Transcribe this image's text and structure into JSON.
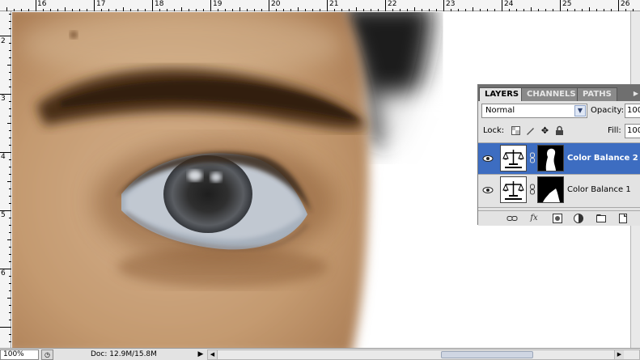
{
  "ruler": {
    "top_ticks": [
      "16",
      "17",
      "18",
      "19",
      "20",
      "21",
      "22",
      "23",
      "24",
      "25",
      "26"
    ],
    "left_ticks": [
      "2",
      "3",
      "4",
      "5",
      "6"
    ]
  },
  "status": {
    "zoom": "100%",
    "doc_info": "Doc: 12.9M/15.8M"
  },
  "layers_panel": {
    "tabs": [
      {
        "label": "LAYERS",
        "active": true
      },
      {
        "label": "CHANNELS",
        "active": false
      },
      {
        "label": "PATHS",
        "active": false
      }
    ],
    "blend_mode": "Normal",
    "opacity_label": "Opacity:",
    "opacity_value": "100",
    "lock_label": "Lock:",
    "fill_label": "Fill:",
    "fill_value": "100",
    "layers": [
      {
        "name": "Color Balance 2",
        "selected": true
      },
      {
        "name": "Color Balance 1",
        "selected": false
      }
    ],
    "icons": {
      "visibility": "eye-icon",
      "adjustment": "balance-scale-icon",
      "link": "chain-link-icon",
      "menu": "panel-menu-icon"
    }
  },
  "colors": {
    "selection": "#3d6dc1",
    "skin": "#c9a47c",
    "hair": "#2a1d14"
  }
}
